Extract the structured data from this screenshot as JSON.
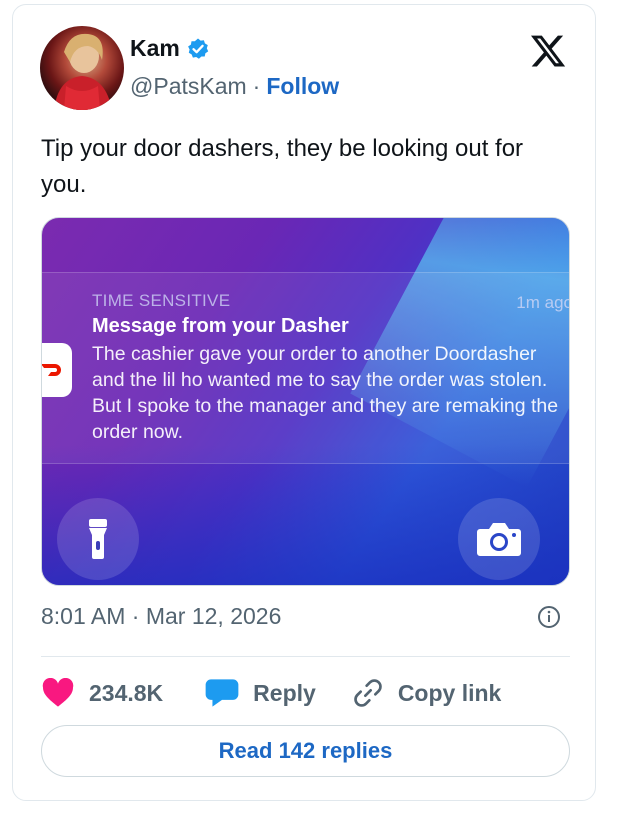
{
  "author": {
    "name": "Kam",
    "handle": "@PatsKam",
    "separator": "·",
    "follow_label": "Follow",
    "verified": true
  },
  "tweet": {
    "text": "Tip your door dashers, they be looking out for you."
  },
  "media": {
    "notification": {
      "kind": "TIME SENSITIVE",
      "time": "1m ago",
      "title": "Message from your Dasher",
      "body": "The cashier gave your order to another Doordasher and the lil ho wanted me to say the order was stolen. But I spoke to the manager and they are remaking the order now.",
      "app_icon": "doordash-icon"
    },
    "buttons": [
      "flashlight-icon",
      "camera-icon"
    ]
  },
  "meta": {
    "timestamp": "8:01 AM · Mar 12, 2026"
  },
  "actions": {
    "likes": "234.8K",
    "reply_label": "Reply",
    "copy_label": "Copy link"
  },
  "read_replies": "Read 142 replies",
  "colors": {
    "accent": "#1d68c4",
    "like": "#f91880",
    "reply_bubble": "#1d9bf0",
    "text_primary": "#0f1419",
    "text_secondary": "#536471"
  }
}
